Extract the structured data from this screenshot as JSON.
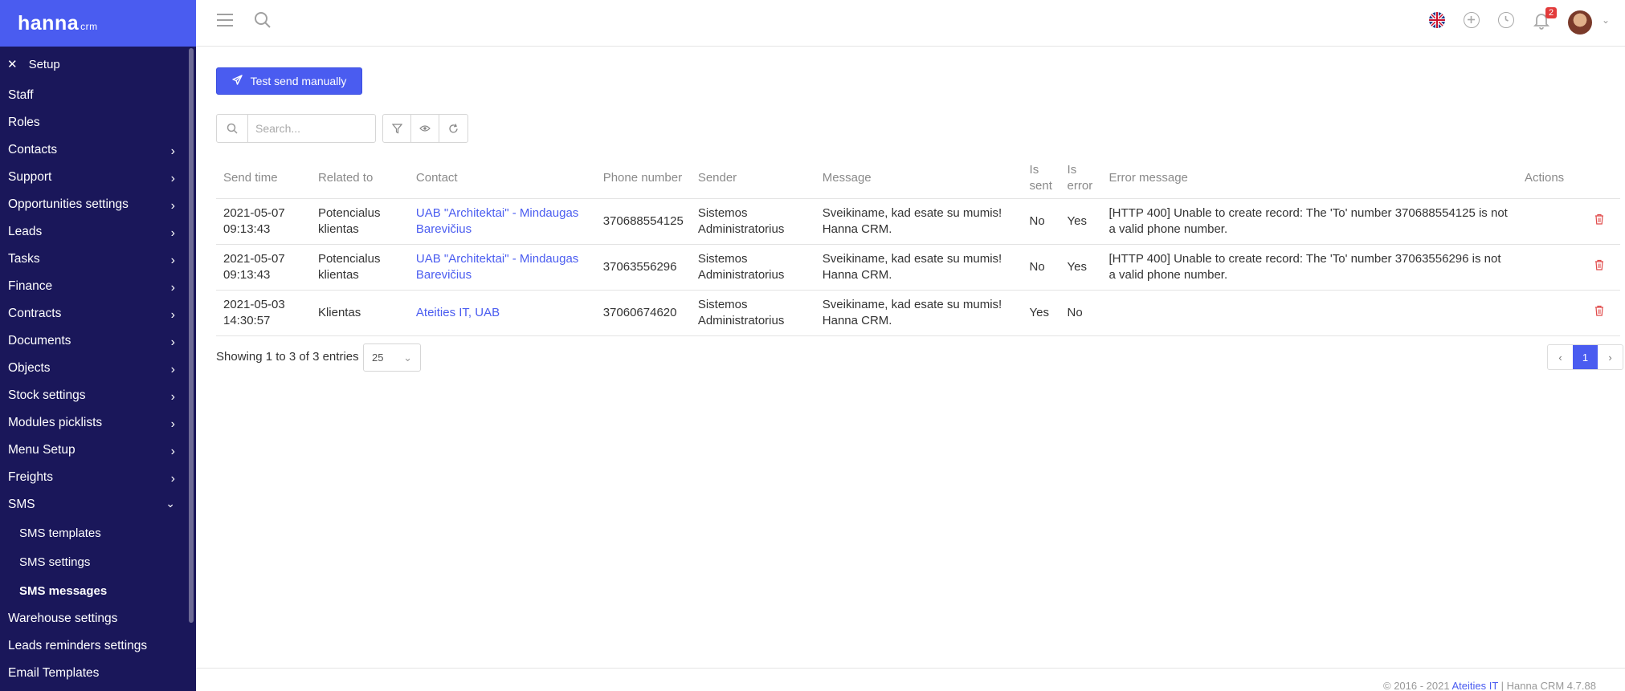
{
  "brand": {
    "logo": "hanna",
    "logo_suffix": "crm",
    "accent": "#4a5cf0",
    "sidebar_bg": "#1a175a"
  },
  "sidebar": {
    "section_title": "Setup",
    "items": [
      {
        "label": "Staff",
        "has_children": false
      },
      {
        "label": "Roles",
        "has_children": false
      },
      {
        "label": "Contacts",
        "has_children": true
      },
      {
        "label": "Support",
        "has_children": true
      },
      {
        "label": "Opportunities settings",
        "has_children": true
      },
      {
        "label": "Leads",
        "has_children": true
      },
      {
        "label": "Tasks",
        "has_children": true
      },
      {
        "label": "Finance",
        "has_children": true
      },
      {
        "label": "Contracts",
        "has_children": true
      },
      {
        "label": "Documents",
        "has_children": true
      },
      {
        "label": "Objects",
        "has_children": true
      },
      {
        "label": "Stock settings",
        "has_children": true
      },
      {
        "label": "Modules picklists",
        "has_children": true
      },
      {
        "label": "Menu Setup",
        "has_children": true
      },
      {
        "label": "Freights",
        "has_children": true
      },
      {
        "label": "SMS",
        "has_children": true,
        "expanded": true
      },
      {
        "label": "SMS templates",
        "sub": true
      },
      {
        "label": "SMS settings",
        "sub": true
      },
      {
        "label": "SMS messages",
        "sub": true,
        "active": true
      },
      {
        "label": "Warehouse settings",
        "has_children": false
      },
      {
        "label": "Leads reminders settings",
        "has_children": false
      },
      {
        "label": "Email Templates",
        "has_children": false
      }
    ]
  },
  "topbar": {
    "notification_count": "2"
  },
  "toolbar": {
    "test_send_label": "Test send manually",
    "search_placeholder": "Search..."
  },
  "table": {
    "columns": [
      "Send time",
      "Related to",
      "Contact",
      "Phone number",
      "Sender",
      "Message",
      "Is sent",
      "Is error",
      "Error message",
      "Actions"
    ],
    "rows": [
      {
        "send_time": "2021-05-07 09:13:43",
        "related_to": "Potencialus klientas",
        "contact": "UAB \"Architektai\" - Mindaugas Barevičius",
        "phone": "370688554125",
        "sender": "Sistemos Administratorius",
        "message": "Sveikiname, kad esate su mumis! Hanna CRM.",
        "is_sent": "No",
        "is_error": "Yes",
        "error_message": "[HTTP 400] Unable to create record: The 'To' number 370688554125 is not a valid phone number."
      },
      {
        "send_time": "2021-05-07 09:13:43",
        "related_to": "Potencialus klientas",
        "contact": "UAB \"Architektai\" - Mindaugas Barevičius",
        "phone": "37063556296",
        "sender": "Sistemos Administratorius",
        "message": "Sveikiname, kad esate su mumis! Hanna CRM.",
        "is_sent": "No",
        "is_error": "Yes",
        "error_message": "[HTTP 400] Unable to create record: The 'To' number 37063556296 is not a valid phone number."
      },
      {
        "send_time": "2021-05-03 14:30:57",
        "related_to": "Klientas",
        "contact": "Ateities IT, UAB",
        "phone": "37060674620",
        "sender": "Sistemos Administratorius",
        "message": "Sveikiname, kad esate su mumis! Hanna CRM.",
        "is_sent": "Yes",
        "is_error": "No",
        "error_message": ""
      }
    ]
  },
  "pagination": {
    "info": "Showing 1 to 3 of 3 entries",
    "page_size": "25",
    "current_page": "1"
  },
  "footer": {
    "prefix": "© 2016 - 2021 ",
    "company": "Ateities IT",
    "suffix": " | Hanna CRM 4.7.88"
  }
}
